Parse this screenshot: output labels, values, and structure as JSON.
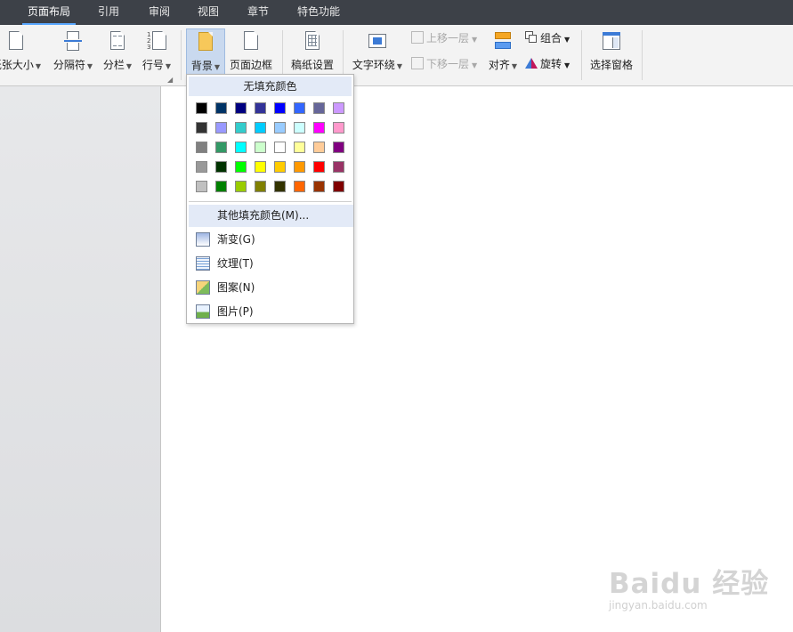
{
  "tabs": [
    "页面布局",
    "引用",
    "审阅",
    "视图",
    "章节",
    "特色功能"
  ],
  "ribbon": {
    "paper_size": "纸张大小",
    "separator": "分隔符",
    "columns": "分栏",
    "line_numbers": "行号",
    "background": "背景",
    "page_border": "页面边框",
    "manuscript": "稿纸设置",
    "text_wrap": "文字环绕",
    "bring_forward": "上移一层",
    "send_backward": "下移一层",
    "align": "对齐",
    "group": "组合",
    "rotate": "旋转",
    "selection_pane": "选择窗格"
  },
  "menu": {
    "no_fill": "无填充颜色",
    "more_colors": "其他填充颜色(M)...",
    "items": [
      "渐变(G)",
      "纹理(T)",
      "图案(N)",
      "图片(P)"
    ],
    "swatches": [
      [
        "#000000",
        "#003366",
        "#000080",
        "#333399",
        "#0000ff",
        "#3366ff",
        "#666699",
        "#cc99ff"
      ],
      [
        "#333333",
        "#9999ff",
        "#33cccc",
        "#00ccff",
        "#99ccff",
        "#ccffff",
        "#ff00ff",
        "#ff99cc"
      ],
      [
        "#808080",
        "#339966",
        "#00ffff",
        "#ccffcc",
        "#ffffff",
        "#ffff99",
        "#ffcc99",
        "#800080"
      ],
      [
        "#999999",
        "#003300",
        "#00ff00",
        "#ffff00",
        "#ffcc00",
        "#ff9900",
        "#ff0000",
        "#993366"
      ],
      [
        "#c0c0c0",
        "#008000",
        "#99cc00",
        "#808000",
        "#333300",
        "#ff6600",
        "#993300",
        "#800000"
      ]
    ]
  },
  "watermark": {
    "logo": "Baidu 经验",
    "url": "jingyan.baidu.com"
  }
}
